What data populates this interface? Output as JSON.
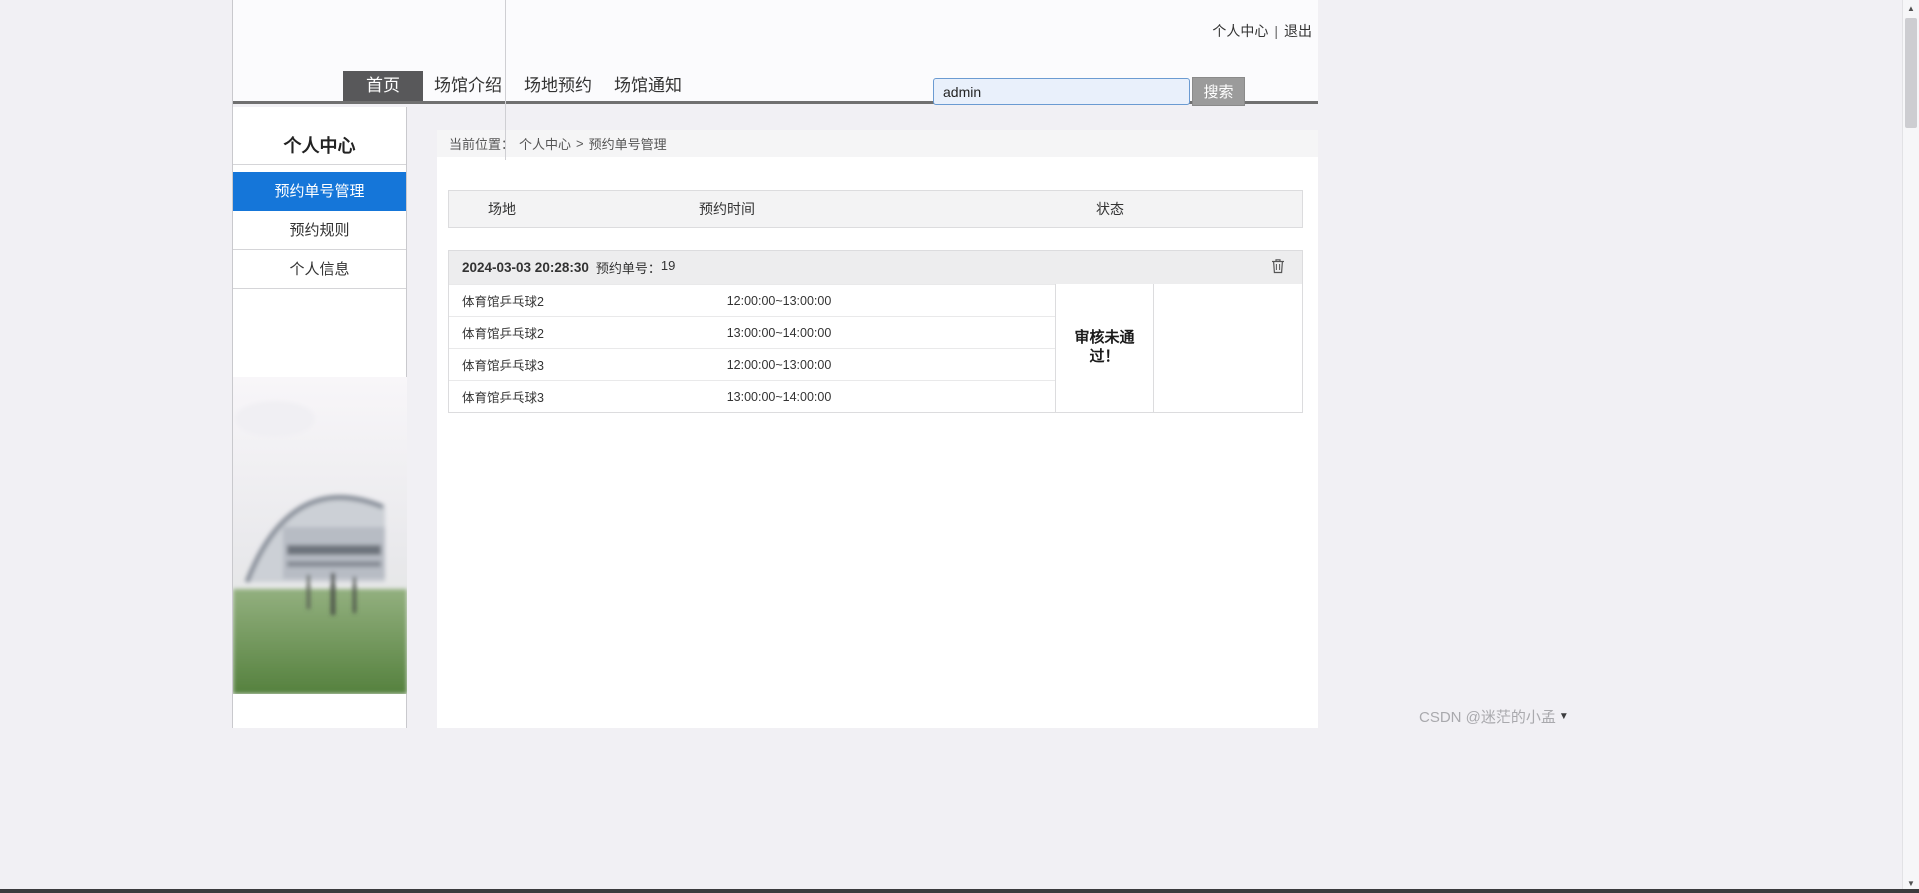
{
  "colors": {
    "accent_blue": "#1576d9",
    "active_tab_bg": "#58585a",
    "search_input_bg": "#e9f0fb",
    "search_input_border": "#6b9bd2",
    "nav_underline": "#707070"
  },
  "topbar": {
    "profile_link": "个人中心",
    "separator": "|",
    "logout_link": "退出"
  },
  "nav": {
    "tabs": [
      {
        "label": "首页",
        "active": true
      },
      {
        "label": "场馆介绍",
        "active": false
      },
      {
        "label": "场地预约",
        "active": false
      },
      {
        "label": "场馆通知",
        "active": false
      }
    ],
    "search": {
      "value": "admin",
      "button_label": "搜索"
    }
  },
  "sidebar": {
    "title": "个人中心",
    "items": [
      {
        "label": "预约单号管理",
        "active": true
      },
      {
        "label": "预约规则",
        "active": false
      },
      {
        "label": "个人信息",
        "active": false
      }
    ]
  },
  "breadcrumb": {
    "prefix": "当前位置：",
    "link1": "个人中心",
    "separator": ">",
    "link2": "预约单号管理"
  },
  "booking": {
    "headers": [
      "场地",
      "预约时间",
      "状态"
    ],
    "group": {
      "datetime": "2024-03-03 20:28:30",
      "order_label": "预约单号：",
      "order_no": "19",
      "status": "审核未通过！",
      "rows": [
        {
          "venue": "体育馆乒乓球2",
          "time": "12:00:00~13:00:00"
        },
        {
          "venue": "体育馆乒乓球2",
          "time": "13:00:00~14:00:00"
        },
        {
          "venue": "体育馆乒乓球3",
          "time": "12:00:00~13:00:00"
        },
        {
          "venue": "体育馆乒乓球3",
          "time": "13:00:00~14:00:00"
        }
      ]
    }
  },
  "watermark": "CSDN @迷茫的小孟"
}
